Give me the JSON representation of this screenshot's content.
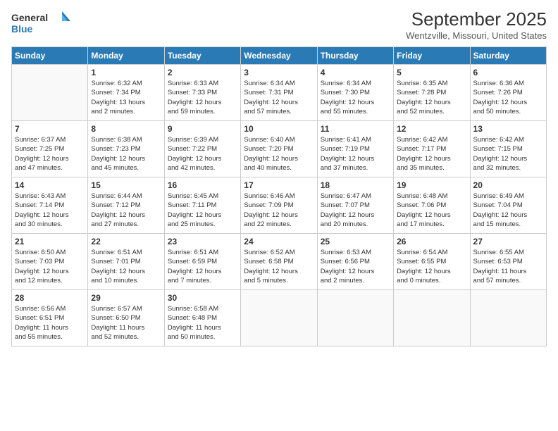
{
  "header": {
    "logo_line1": "General",
    "logo_line2": "Blue",
    "month_title": "September 2025",
    "location": "Wentzville, Missouri, United States"
  },
  "calendar": {
    "days_of_week": [
      "Sunday",
      "Monday",
      "Tuesday",
      "Wednesday",
      "Thursday",
      "Friday",
      "Saturday"
    ],
    "weeks": [
      [
        {
          "day": "",
          "info": ""
        },
        {
          "day": "1",
          "info": "Sunrise: 6:32 AM\nSunset: 7:34 PM\nDaylight: 13 hours\nand 2 minutes."
        },
        {
          "day": "2",
          "info": "Sunrise: 6:33 AM\nSunset: 7:33 PM\nDaylight: 12 hours\nand 59 minutes."
        },
        {
          "day": "3",
          "info": "Sunrise: 6:34 AM\nSunset: 7:31 PM\nDaylight: 12 hours\nand 57 minutes."
        },
        {
          "day": "4",
          "info": "Sunrise: 6:34 AM\nSunset: 7:30 PM\nDaylight: 12 hours\nand 55 minutes."
        },
        {
          "day": "5",
          "info": "Sunrise: 6:35 AM\nSunset: 7:28 PM\nDaylight: 12 hours\nand 52 minutes."
        },
        {
          "day": "6",
          "info": "Sunrise: 6:36 AM\nSunset: 7:26 PM\nDaylight: 12 hours\nand 50 minutes."
        }
      ],
      [
        {
          "day": "7",
          "info": "Sunrise: 6:37 AM\nSunset: 7:25 PM\nDaylight: 12 hours\nand 47 minutes."
        },
        {
          "day": "8",
          "info": "Sunrise: 6:38 AM\nSunset: 7:23 PM\nDaylight: 12 hours\nand 45 minutes."
        },
        {
          "day": "9",
          "info": "Sunrise: 6:39 AM\nSunset: 7:22 PM\nDaylight: 12 hours\nand 42 minutes."
        },
        {
          "day": "10",
          "info": "Sunrise: 6:40 AM\nSunset: 7:20 PM\nDaylight: 12 hours\nand 40 minutes."
        },
        {
          "day": "11",
          "info": "Sunrise: 6:41 AM\nSunset: 7:19 PM\nDaylight: 12 hours\nand 37 minutes."
        },
        {
          "day": "12",
          "info": "Sunrise: 6:42 AM\nSunset: 7:17 PM\nDaylight: 12 hours\nand 35 minutes."
        },
        {
          "day": "13",
          "info": "Sunrise: 6:42 AM\nSunset: 7:15 PM\nDaylight: 12 hours\nand 32 minutes."
        }
      ],
      [
        {
          "day": "14",
          "info": "Sunrise: 6:43 AM\nSunset: 7:14 PM\nDaylight: 12 hours\nand 30 minutes."
        },
        {
          "day": "15",
          "info": "Sunrise: 6:44 AM\nSunset: 7:12 PM\nDaylight: 12 hours\nand 27 minutes."
        },
        {
          "day": "16",
          "info": "Sunrise: 6:45 AM\nSunset: 7:11 PM\nDaylight: 12 hours\nand 25 minutes."
        },
        {
          "day": "17",
          "info": "Sunrise: 6:46 AM\nSunset: 7:09 PM\nDaylight: 12 hours\nand 22 minutes."
        },
        {
          "day": "18",
          "info": "Sunrise: 6:47 AM\nSunset: 7:07 PM\nDaylight: 12 hours\nand 20 minutes."
        },
        {
          "day": "19",
          "info": "Sunrise: 6:48 AM\nSunset: 7:06 PM\nDaylight: 12 hours\nand 17 minutes."
        },
        {
          "day": "20",
          "info": "Sunrise: 6:49 AM\nSunset: 7:04 PM\nDaylight: 12 hours\nand 15 minutes."
        }
      ],
      [
        {
          "day": "21",
          "info": "Sunrise: 6:50 AM\nSunset: 7:03 PM\nDaylight: 12 hours\nand 12 minutes."
        },
        {
          "day": "22",
          "info": "Sunrise: 6:51 AM\nSunset: 7:01 PM\nDaylight: 12 hours\nand 10 minutes."
        },
        {
          "day": "23",
          "info": "Sunrise: 6:51 AM\nSunset: 6:59 PM\nDaylight: 12 hours\nand 7 minutes."
        },
        {
          "day": "24",
          "info": "Sunrise: 6:52 AM\nSunset: 6:58 PM\nDaylight: 12 hours\nand 5 minutes."
        },
        {
          "day": "25",
          "info": "Sunrise: 6:53 AM\nSunset: 6:56 PM\nDaylight: 12 hours\nand 2 minutes."
        },
        {
          "day": "26",
          "info": "Sunrise: 6:54 AM\nSunset: 6:55 PM\nDaylight: 12 hours\nand 0 minutes."
        },
        {
          "day": "27",
          "info": "Sunrise: 6:55 AM\nSunset: 6:53 PM\nDaylight: 11 hours\nand 57 minutes."
        }
      ],
      [
        {
          "day": "28",
          "info": "Sunrise: 6:56 AM\nSunset: 6:51 PM\nDaylight: 11 hours\nand 55 minutes."
        },
        {
          "day": "29",
          "info": "Sunrise: 6:57 AM\nSunset: 6:50 PM\nDaylight: 11 hours\nand 52 minutes."
        },
        {
          "day": "30",
          "info": "Sunrise: 6:58 AM\nSunset: 6:48 PM\nDaylight: 11 hours\nand 50 minutes."
        },
        {
          "day": "",
          "info": ""
        },
        {
          "day": "",
          "info": ""
        },
        {
          "day": "",
          "info": ""
        },
        {
          "day": "",
          "info": ""
        }
      ]
    ]
  }
}
